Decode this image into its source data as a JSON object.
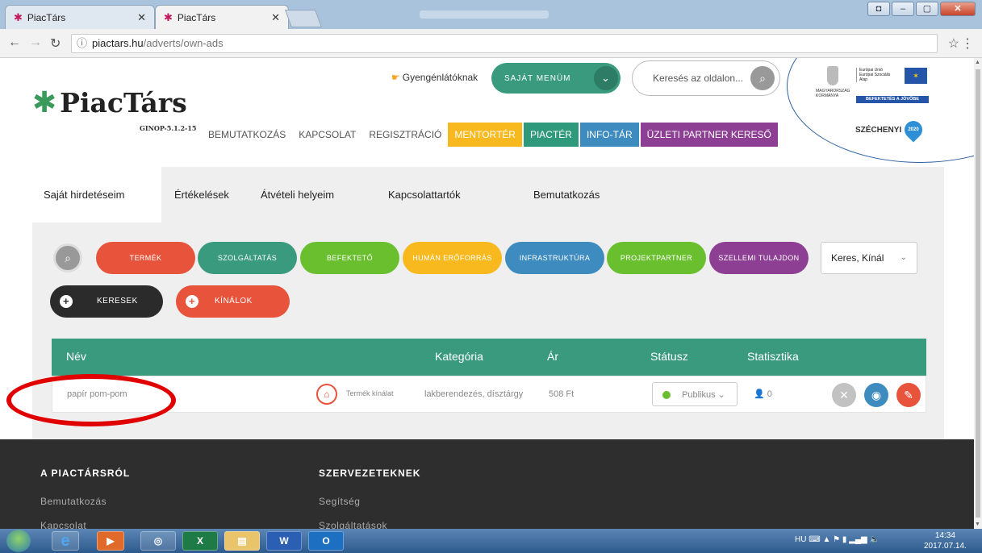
{
  "browser": {
    "tabs": [
      {
        "title": "PiacTárs",
        "active": false
      },
      {
        "title": "PiacTárs",
        "active": true
      }
    ],
    "url_host": "piactars.hu",
    "url_path": "/adverts/own-ads"
  },
  "site": {
    "logo_text": "PiacTárs",
    "logo_sub": "GINOP-5.1.2-15",
    "accessibility_label": "Gyengénlátóknak",
    "my_menu_label": "SAJÁT MENÜM",
    "search_placeholder": "Keresés az oldalon...",
    "nav": [
      "BEMUTATKOZÁS",
      "KAPCSOLAT",
      "REGISZTRÁCIÓ",
      "MENTORTÉR",
      "PIACTÉR",
      "INFO-TÁR",
      "ÜZLETI PARTNER KERESŐ"
    ],
    "nav_colors": {
      "MENTORTÉR": "#f7b91d",
      "PIACTÉR": "#2f9a7b",
      "INFO-TÁR": "#3d8bbf",
      "ÜZLETI PARTNER KERESŐ": "#8c3f93"
    },
    "eu": {
      "kormany": "MAGYARORSZÁG\nKORMÁNYA",
      "fund": "Európai Unió\nEurópai Szociális\nAlap",
      "bar": "BEFEKTETÉS A JÖVŐBE",
      "szechenyi": "SZÉCHENYI",
      "szechenyi_badge": "2020"
    }
  },
  "subtabs": [
    "Saját hirdetéseim",
    "Értékelések",
    "Átvételi helyeim",
    "Kapcsolattartók",
    "Bemutatkozás"
  ],
  "filters": {
    "categories": [
      {
        "label": "TERMÉK",
        "color": "#e8533b"
      },
      {
        "label": "SZOLGÁLTATÁS",
        "color": "#3a9a7d"
      },
      {
        "label": "BEFEKTETŐ",
        "color": "#6abf2e"
      },
      {
        "label": "HUMÁN ERŐFORRÁS",
        "color": "#f7b91d"
      },
      {
        "label": "INFRASTRUKTÚRA",
        "color": "#3d8bbf"
      },
      {
        "label": "PROJEKTPARTNER",
        "color": "#6abf2e"
      },
      {
        "label": "SZELLEMI TULAJDON",
        "color": "#8c3f93"
      }
    ],
    "select_value": "Keres, Kínál",
    "keresek_label": "KERESEK",
    "kinalok_label": "KÍNÁLOK"
  },
  "table": {
    "headers": {
      "name": "Név",
      "category": "Kategória",
      "price": "Ár",
      "status": "Státusz",
      "stats": "Statisztika"
    },
    "rows": [
      {
        "name": "papír pom-pom",
        "type": "Termék kínálat",
        "category": "lakberendezés, dísztárgy",
        "price": "508 Ft",
        "status": "Publikus",
        "stat_count": "0"
      }
    ]
  },
  "footer": {
    "col1_title": "A PIACTÁRSRÓL",
    "col1_links": [
      "Bemutatkozás",
      "Kapcsolat"
    ],
    "col2_title": "SZERVEZETEKNEK",
    "col2_links": [
      "Segítség",
      "Szolgáltatások"
    ]
  },
  "taskbar": {
    "lang": "HU",
    "time": "14:34",
    "date": "2017.07.14."
  }
}
